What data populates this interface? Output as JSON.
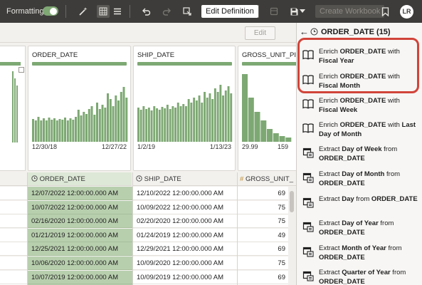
{
  "toolbar": {
    "formatting_label": "Formatting",
    "edit_definition": "Edit Definition",
    "create_workbook": "Create Workbook",
    "avatar_initials": "LR",
    "icons": [
      "magic-wand-icon",
      "grid-view-icon",
      "list-view-icon",
      "undo-icon",
      "redo-icon",
      "data-diagram-icon",
      "database-icon",
      "save-icon",
      "chevron-down-icon",
      "bookmark-icon"
    ]
  },
  "subbar": {
    "edit_button": "Edit"
  },
  "columns": [
    {
      "name": "ORDER_DATE",
      "header_label": "ORDER_DATE",
      "header_icon": "clock-icon",
      "x_min_label": "12/30/18",
      "x_max_label": "12/27/22",
      "histogram": [
        0.32,
        0.3,
        0.35,
        0.3,
        0.33,
        0.3,
        0.34,
        0.31,
        0.33,
        0.3,
        0.32,
        0.31,
        0.34,
        0.3,
        0.33,
        0.31,
        0.35,
        0.45,
        0.37,
        0.42,
        0.39,
        0.46,
        0.5,
        0.38,
        0.55,
        0.46,
        0.52,
        0.48,
        0.68,
        0.6,
        0.5,
        0.65,
        0.58,
        0.7,
        0.77,
        0.62
      ],
      "values": [
        "12/07/2022 12:00:00.000 AM",
        "10/07/2022 12:00:00.000 AM",
        "02/16/2020 12:00:00.000 AM",
        "01/21/2019 12:00:00.000 AM",
        "12/25/2021 12:00:00.000 AM",
        "10/06/2020 12:00:00.000 AM",
        "10/07/2019 12:00:00.000 AM",
        "01/19/2019 12:00:00.000 AM"
      ]
    },
    {
      "name": "SHIP_DATE",
      "header_label": "SHIP_DATE",
      "header_icon": "clock-icon",
      "x_min_label": "1/2/19",
      "x_max_label": "1/13/23",
      "histogram": [
        0.48,
        0.45,
        0.5,
        0.46,
        0.48,
        0.44,
        0.5,
        0.47,
        0.45,
        0.49,
        0.47,
        0.52,
        0.46,
        0.5,
        0.48,
        0.55,
        0.5,
        0.53,
        0.5,
        0.6,
        0.55,
        0.62,
        0.58,
        0.65,
        0.55,
        0.7,
        0.62,
        0.68,
        0.6,
        0.75,
        0.7,
        0.8,
        0.65,
        0.72,
        0.78,
        0.68
      ],
      "values": [
        "12/10/2022 12:00:00.000 AM",
        "10/09/2022 12:00:00.000 AM",
        "02/20/2020 12:00:00.000 AM",
        "01/24/2019 12:00:00.000 AM",
        "12/29/2021 12:00:00.000 AM",
        "10/09/2020 12:00:00.000 AM",
        "10/09/2019 12:00:00.000 AM",
        "01/20/2019 12:00:00.000 AM"
      ]
    },
    {
      "name": "GROSS_UNIT_PRICE",
      "title_label": "GROSS_UNIT_PI",
      "header_label": "GROSS_UNIT_",
      "header_icon": "hash-icon",
      "x_min_label": "29.99",
      "x_max_label": "159",
      "histogram": [
        0.95,
        0.62,
        0.42,
        0.3,
        0.18,
        0.12,
        0.08,
        0.06
      ],
      "values": [
        "69",
        "75",
        "75",
        "49",
        "69",
        "75",
        "69",
        "69"
      ]
    }
  ],
  "panel": {
    "title": "ORDER_DATE (15)",
    "back_icon": "arrow-left-icon",
    "history_icon": "clock-icon",
    "items": [
      {
        "icon": "book-icon",
        "pre": "Enrich ",
        "bold": "ORDER_DATE",
        "mid": " with ",
        "bold2": "Fiscal Year",
        "post": ""
      },
      {
        "icon": "book-icon",
        "pre": "Enrich ",
        "bold": "ORDER_DATE",
        "mid": " with ",
        "bold2": "Fiscal Month",
        "post": ""
      },
      {
        "icon": "book-icon",
        "pre": "Enrich ",
        "bold": "ORDER_DATE",
        "mid": " with ",
        "bold2": "Fiscal Week",
        "post": ""
      },
      {
        "icon": "book-icon",
        "pre": "Enrich ",
        "bold": "ORDER_DATE",
        "mid": " with ",
        "bold2": "Last Day of Month",
        "post": ""
      },
      {
        "icon": "calendar-extract-icon",
        "pre": "Extract ",
        "bold": "Day of Week",
        "mid": " from ",
        "bold2": "ORDER_DATE",
        "post": ""
      },
      {
        "icon": "calendar-extract-icon",
        "pre": "Extract ",
        "bold": "Day of Month",
        "mid": " from ",
        "bold2": "ORDER_DATE",
        "post": ""
      },
      {
        "icon": "calendar-extract-icon",
        "pre": "Extract ",
        "bold": "Day",
        "mid": " from ",
        "bold2": "ORDER_DATE",
        "post": ""
      },
      {
        "icon": "calendar-extract-icon",
        "pre": "Extract ",
        "bold": "Day of Year",
        "mid": " from ",
        "bold2": "ORDER_DATE",
        "post": ""
      },
      {
        "icon": "calendar-extract-icon",
        "pre": "Extract ",
        "bold": "Month of Year",
        "mid": " from ",
        "bold2": "ORDER_DATE",
        "post": ""
      },
      {
        "icon": "calendar-extract-icon",
        "pre": "Extract ",
        "bold": "Quarter of Year",
        "mid": " from ",
        "bold2": "ORDER_DATE",
        "post": ""
      }
    ]
  },
  "colors": {
    "bar": "#7da873",
    "selected": "#b8cfae",
    "highlight": "#d1443a",
    "toolbar": "#3d3c3a"
  }
}
